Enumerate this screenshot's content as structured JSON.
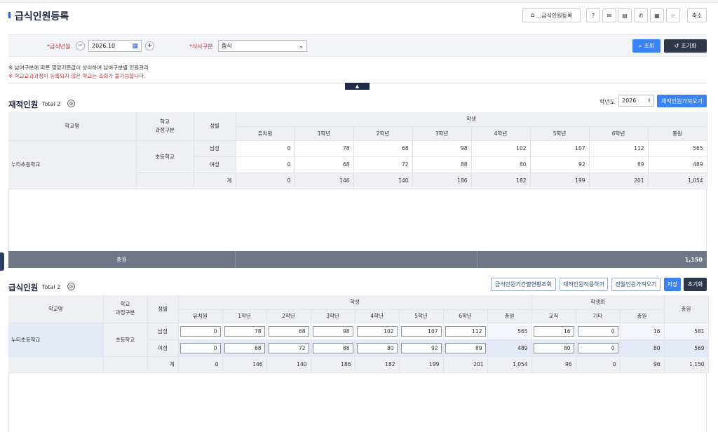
{
  "page": {
    "title": "급식인원등록",
    "breadcrumb_btn": "...급식인원등록",
    "shrink_btn": "축소",
    "icons": [
      "help-icon",
      "message-icon",
      "document-icon",
      "phone-icon",
      "calendar-icon",
      "star-icon"
    ]
  },
  "conditions": {
    "date_label": "*급식년월",
    "date_value": "2026.10",
    "meal_label": "*식사구분",
    "meal_value": "중식",
    "search_btn": "조회",
    "reset_btn": "초기화",
    "notes": [
      "※ 남여구분에 따른 영양기준값이 상이하여 남여구분별 인원관리",
      "※ 학교교과과정이 등록되지 않은 학교는 조회가 불가능합니다."
    ]
  },
  "enrolled": {
    "title": "재적인원",
    "total": "Total 2",
    "year_label": "학년도",
    "year_value": "2026",
    "fetch_btn": "재적인원가져오기",
    "headers": {
      "school": "학교명",
      "course": "학교\n과정구분",
      "gender": "성별",
      "student": "학생",
      "cols": [
        "유치원",
        "1학년",
        "2학년",
        "3학년",
        "4학년",
        "5학년",
        "6학년",
        "총원"
      ]
    },
    "school_name": "누티초등학교",
    "course_name": "초등학교",
    "rows": [
      {
        "gender": "남성",
        "values": [
          "0",
          "78",
          "68",
          "98",
          "102",
          "107",
          "112",
          "565"
        ]
      },
      {
        "gender": "여성",
        "values": [
          "0",
          "68",
          "72",
          "88",
          "80",
          "92",
          "89",
          "489"
        ]
      }
    ],
    "sum_row": {
      "label": "계",
      "values": [
        "0",
        "146",
        "140",
        "186",
        "182",
        "199",
        "201",
        "1,054"
      ]
    },
    "grand_label": "총원",
    "grand_value": "1,150"
  },
  "meals": {
    "title": "급식인원",
    "total": "Total 2",
    "btn_period": "급식인원기간별현황조회",
    "btn_apply": "재적인원적용하기",
    "btn_prev": "전월인원가져오기",
    "btn_save": "저장",
    "btn_reset": "초기화",
    "headers": {
      "school": "학교명",
      "course": "학교\n과정구분",
      "gender": "성별",
      "student": "학생",
      "outside": "학생외",
      "grand": "총원",
      "student_cols": [
        "유치원",
        "1학년",
        "2학년",
        "3학년",
        "4학년",
        "5학년",
        "6학년",
        "총원"
      ],
      "outside_cols": [
        "교직",
        "기타",
        "총원"
      ]
    },
    "school_name": "누티초등학교",
    "course_name": "초등학교",
    "rows": [
      {
        "gender": "남성",
        "students": [
          "0",
          "78",
          "68",
          "98",
          "102",
          "107",
          "112"
        ],
        "student_total": "565",
        "staff": "16",
        "other": "0",
        "outside_total": "16",
        "grand": "581"
      },
      {
        "gender": "여성",
        "students": [
          "0",
          "68",
          "72",
          "88",
          "80",
          "92",
          "89"
        ],
        "student_total": "489",
        "staff": "80",
        "other": "0",
        "outside_total": "80",
        "grand": "569"
      }
    ],
    "sum_row": {
      "label": "계",
      "students": [
        "0",
        "146",
        "140",
        "186",
        "182",
        "199",
        "201"
      ],
      "student_total": "1,054",
      "staff": "96",
      "other": "0",
      "outside_total": "96",
      "grand": "1,150"
    }
  }
}
